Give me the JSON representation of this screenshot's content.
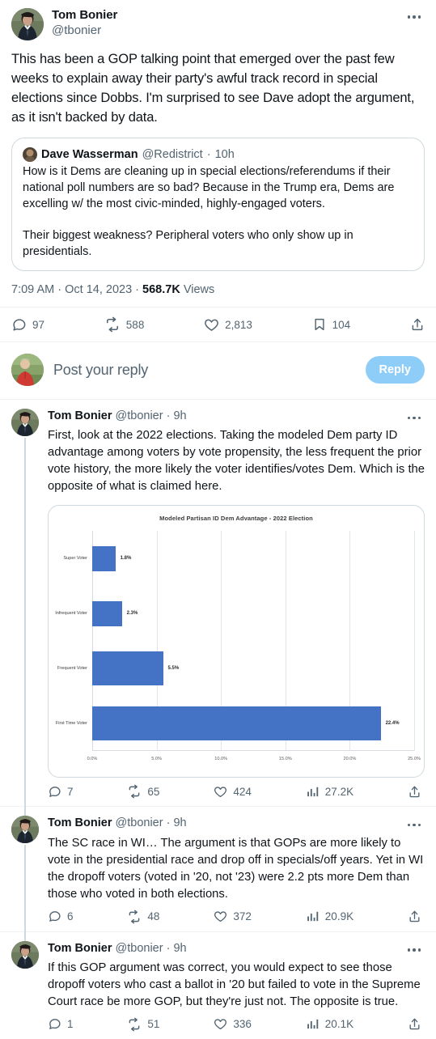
{
  "main_tweet": {
    "display_name": "Tom Bonier",
    "handle": "@tbonier",
    "more_icon": "more-horizontal-icon",
    "body": "This has been a GOP talking point that emerged over the past few weeks to explain away their party's awful track record in special elections since Dobbs. I'm surprised to see Dave adopt the argument, as it isn't backed by data.",
    "quote": {
      "display_name": "Dave Wasserman",
      "handle": "@Redistrict",
      "separator": "·",
      "time": "10h",
      "paragraph1": "How is it Dems are cleaning up in special elections/referendums if their national poll numbers are so bad? Because in the Trump era, Dems are excelling w/ the most civic-minded, highly-engaged voters.",
      "paragraph2": "Their biggest weakness? Peripheral voters who only show up in presidentials."
    },
    "timestamp": {
      "time": "7:09 AM",
      "sep1": "·",
      "date": "Oct 14, 2023",
      "sep2": "·",
      "views_count": "568.7K",
      "views_label": "Views"
    },
    "actions": {
      "reply": {
        "icon": "reply-icon",
        "count": "97"
      },
      "retweet": {
        "icon": "retweet-icon",
        "count": "588"
      },
      "like": {
        "icon": "heart-icon",
        "count": "2,813"
      },
      "bookmark": {
        "icon": "bookmark-icon",
        "count": "104"
      },
      "share": {
        "icon": "share-icon",
        "count": ""
      }
    }
  },
  "composer": {
    "placeholder": "Post your reply",
    "reply_button": "Reply",
    "avatar": "user-avatar"
  },
  "replies": [
    {
      "display_name": "Tom Bonier",
      "handle": "@tbonier",
      "separator": "·",
      "time": "9h",
      "body": "First, look at the 2022 elections. Taking the modeled Dem party ID advantage among voters by vote propensity, the less frequent the prior vote history, the more likely the voter identifies/votes Dem. Which is the opposite of what is claimed here.",
      "actions": {
        "reply": {
          "icon": "reply-icon",
          "count": "7"
        },
        "retweet": {
          "icon": "retweet-icon",
          "count": "65"
        },
        "like": {
          "icon": "heart-icon",
          "count": "424"
        },
        "views": {
          "icon": "analytics-icon",
          "count": "27.2K"
        },
        "share": {
          "icon": "share-icon",
          "count": ""
        }
      }
    },
    {
      "display_name": "Tom Bonier",
      "handle": "@tbonier",
      "separator": "·",
      "time": "9h",
      "body": "The SC race in WI… The argument is that GOPs are more likely to vote in the presidential race and drop off in specials/off years. Yet in WI the dropoff voters (voted in '20, not '23) were 2.2 pts more Dem than those who voted in both elections.",
      "actions": {
        "reply": {
          "icon": "reply-icon",
          "count": "6"
        },
        "retweet": {
          "icon": "retweet-icon",
          "count": "48"
        },
        "like": {
          "icon": "heart-icon",
          "count": "372"
        },
        "views": {
          "icon": "analytics-icon",
          "count": "20.9K"
        },
        "share": {
          "icon": "share-icon",
          "count": ""
        }
      }
    },
    {
      "display_name": "Tom Bonier",
      "handle": "@tbonier",
      "separator": "·",
      "time": "9h",
      "body": "If this GOP argument was correct, you would expect to see those dropoff voters who cast a ballot in '20 but failed to vote in the Supreme Court race be more GOP, but they're just not. The opposite is true.",
      "actions": {
        "reply": {
          "icon": "reply-icon",
          "count": "1"
        },
        "retweet": {
          "icon": "retweet-icon",
          "count": "51"
        },
        "like": {
          "icon": "heart-icon",
          "count": "336"
        },
        "views": {
          "icon": "analytics-icon",
          "count": "20.1K"
        },
        "share": {
          "icon": "share-icon",
          "count": ""
        }
      }
    }
  ],
  "chart_data": {
    "type": "bar",
    "orientation": "horizontal",
    "title": "Modeled Partisan ID Dem Advantage - 2022 Election",
    "categories": [
      "Super Voter",
      "Infrequent Voter",
      "Frequent Voter",
      "First Time Voter"
    ],
    "values": [
      1.8,
      2.3,
      5.5,
      22.4
    ],
    "value_labels": [
      "1.8%",
      "2.3%",
      "5.5%",
      "22.4%"
    ],
    "xlabel": "",
    "ylabel": "",
    "xlim": [
      0,
      25
    ],
    "xticks": [
      0,
      5,
      10,
      15,
      20,
      25
    ],
    "xtick_labels": [
      "0.0%",
      "5.0%",
      "10.0%",
      "15.0%",
      "20.0%",
      "25.0%"
    ],
    "bar_color": "#4472c4",
    "grid": true,
    "legend": false
  },
  "colors": {
    "accent": "#1d9bf0",
    "reply_button": "#8ecdf8",
    "text_secondary": "#536471",
    "border": "#cfd9de",
    "bar": "#4472c4"
  }
}
